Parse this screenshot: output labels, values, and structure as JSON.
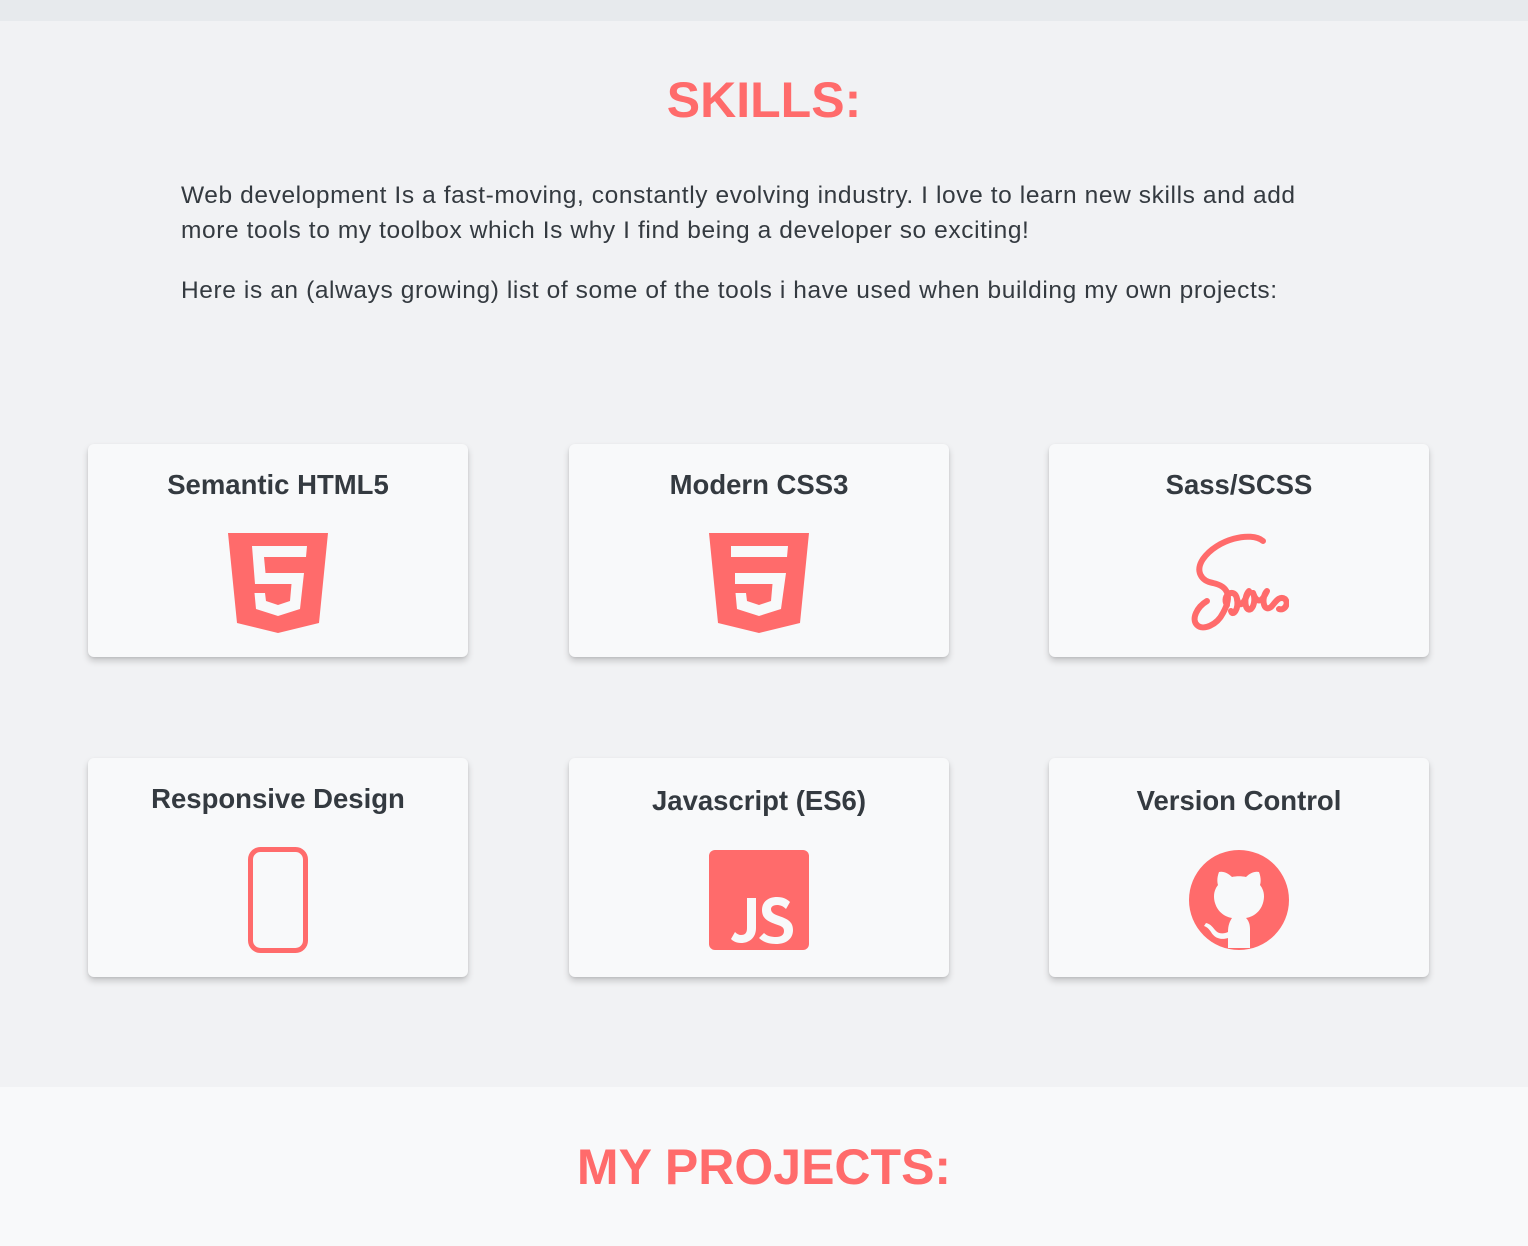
{
  "skills": {
    "title": "SKILLS:",
    "intro_1": "Web development Is a fast-moving, constantly evolving industry. I love to learn new skills and add more tools to my toolbox which Is why I find being a developer so exciting!",
    "intro_2": "Here is an (always growing) list of some of the tools i have used when building my own projects:",
    "cards": [
      {
        "label": "Semantic HTML5",
        "icon": "html5-icon"
      },
      {
        "label": "Modern CSS3",
        "icon": "css3-icon"
      },
      {
        "label": "Sass/SCSS",
        "icon": "sass-icon"
      },
      {
        "label": "Responsive Design",
        "icon": "mobile-phone-icon"
      },
      {
        "label": "Javascript (ES6)",
        "icon": "javascript-icon"
      },
      {
        "label": "Version Control",
        "icon": "github-icon"
      }
    ]
  },
  "projects": {
    "title": "MY PROJECTS:"
  },
  "colors": {
    "accent": "#ff6b6b",
    "text": "#343a40",
    "background": "#f1f2f4",
    "card": "#f8f9fa"
  }
}
